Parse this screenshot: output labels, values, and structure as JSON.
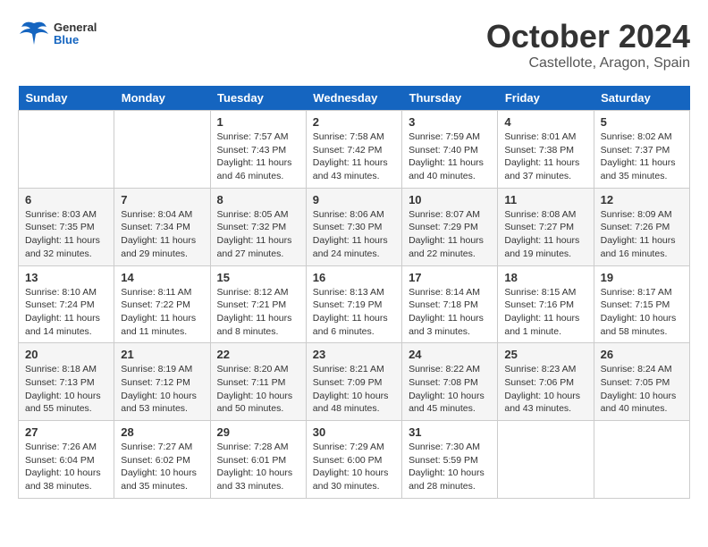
{
  "header": {
    "logo_general": "General",
    "logo_blue": "Blue",
    "month_title": "October 2024",
    "location": "Castellote, Aragon, Spain"
  },
  "days_of_week": [
    "Sunday",
    "Monday",
    "Tuesday",
    "Wednesday",
    "Thursday",
    "Friday",
    "Saturday"
  ],
  "weeks": [
    [
      {
        "day": "",
        "sunrise": "",
        "sunset": "",
        "daylight": ""
      },
      {
        "day": "",
        "sunrise": "",
        "sunset": "",
        "daylight": ""
      },
      {
        "day": "1",
        "sunrise": "Sunrise: 7:57 AM",
        "sunset": "Sunset: 7:43 PM",
        "daylight": "Daylight: 11 hours and 46 minutes."
      },
      {
        "day": "2",
        "sunrise": "Sunrise: 7:58 AM",
        "sunset": "Sunset: 7:42 PM",
        "daylight": "Daylight: 11 hours and 43 minutes."
      },
      {
        "day": "3",
        "sunrise": "Sunrise: 7:59 AM",
        "sunset": "Sunset: 7:40 PM",
        "daylight": "Daylight: 11 hours and 40 minutes."
      },
      {
        "day": "4",
        "sunrise": "Sunrise: 8:01 AM",
        "sunset": "Sunset: 7:38 PM",
        "daylight": "Daylight: 11 hours and 37 minutes."
      },
      {
        "day": "5",
        "sunrise": "Sunrise: 8:02 AM",
        "sunset": "Sunset: 7:37 PM",
        "daylight": "Daylight: 11 hours and 35 minutes."
      }
    ],
    [
      {
        "day": "6",
        "sunrise": "Sunrise: 8:03 AM",
        "sunset": "Sunset: 7:35 PM",
        "daylight": "Daylight: 11 hours and 32 minutes."
      },
      {
        "day": "7",
        "sunrise": "Sunrise: 8:04 AM",
        "sunset": "Sunset: 7:34 PM",
        "daylight": "Daylight: 11 hours and 29 minutes."
      },
      {
        "day": "8",
        "sunrise": "Sunrise: 8:05 AM",
        "sunset": "Sunset: 7:32 PM",
        "daylight": "Daylight: 11 hours and 27 minutes."
      },
      {
        "day": "9",
        "sunrise": "Sunrise: 8:06 AM",
        "sunset": "Sunset: 7:30 PM",
        "daylight": "Daylight: 11 hours and 24 minutes."
      },
      {
        "day": "10",
        "sunrise": "Sunrise: 8:07 AM",
        "sunset": "Sunset: 7:29 PM",
        "daylight": "Daylight: 11 hours and 22 minutes."
      },
      {
        "day": "11",
        "sunrise": "Sunrise: 8:08 AM",
        "sunset": "Sunset: 7:27 PM",
        "daylight": "Daylight: 11 hours and 19 minutes."
      },
      {
        "day": "12",
        "sunrise": "Sunrise: 8:09 AM",
        "sunset": "Sunset: 7:26 PM",
        "daylight": "Daylight: 11 hours and 16 minutes."
      }
    ],
    [
      {
        "day": "13",
        "sunrise": "Sunrise: 8:10 AM",
        "sunset": "Sunset: 7:24 PM",
        "daylight": "Daylight: 11 hours and 14 minutes."
      },
      {
        "day": "14",
        "sunrise": "Sunrise: 8:11 AM",
        "sunset": "Sunset: 7:22 PM",
        "daylight": "Daylight: 11 hours and 11 minutes."
      },
      {
        "day": "15",
        "sunrise": "Sunrise: 8:12 AM",
        "sunset": "Sunset: 7:21 PM",
        "daylight": "Daylight: 11 hours and 8 minutes."
      },
      {
        "day": "16",
        "sunrise": "Sunrise: 8:13 AM",
        "sunset": "Sunset: 7:19 PM",
        "daylight": "Daylight: 11 hours and 6 minutes."
      },
      {
        "day": "17",
        "sunrise": "Sunrise: 8:14 AM",
        "sunset": "Sunset: 7:18 PM",
        "daylight": "Daylight: 11 hours and 3 minutes."
      },
      {
        "day": "18",
        "sunrise": "Sunrise: 8:15 AM",
        "sunset": "Sunset: 7:16 PM",
        "daylight": "Daylight: 11 hours and 1 minute."
      },
      {
        "day": "19",
        "sunrise": "Sunrise: 8:17 AM",
        "sunset": "Sunset: 7:15 PM",
        "daylight": "Daylight: 10 hours and 58 minutes."
      }
    ],
    [
      {
        "day": "20",
        "sunrise": "Sunrise: 8:18 AM",
        "sunset": "Sunset: 7:13 PM",
        "daylight": "Daylight: 10 hours and 55 minutes."
      },
      {
        "day": "21",
        "sunrise": "Sunrise: 8:19 AM",
        "sunset": "Sunset: 7:12 PM",
        "daylight": "Daylight: 10 hours and 53 minutes."
      },
      {
        "day": "22",
        "sunrise": "Sunrise: 8:20 AM",
        "sunset": "Sunset: 7:11 PM",
        "daylight": "Daylight: 10 hours and 50 minutes."
      },
      {
        "day": "23",
        "sunrise": "Sunrise: 8:21 AM",
        "sunset": "Sunset: 7:09 PM",
        "daylight": "Daylight: 10 hours and 48 minutes."
      },
      {
        "day": "24",
        "sunrise": "Sunrise: 8:22 AM",
        "sunset": "Sunset: 7:08 PM",
        "daylight": "Daylight: 10 hours and 45 minutes."
      },
      {
        "day": "25",
        "sunrise": "Sunrise: 8:23 AM",
        "sunset": "Sunset: 7:06 PM",
        "daylight": "Daylight: 10 hours and 43 minutes."
      },
      {
        "day": "26",
        "sunrise": "Sunrise: 8:24 AM",
        "sunset": "Sunset: 7:05 PM",
        "daylight": "Daylight: 10 hours and 40 minutes."
      }
    ],
    [
      {
        "day": "27",
        "sunrise": "Sunrise: 7:26 AM",
        "sunset": "Sunset: 6:04 PM",
        "daylight": "Daylight: 10 hours and 38 minutes."
      },
      {
        "day": "28",
        "sunrise": "Sunrise: 7:27 AM",
        "sunset": "Sunset: 6:02 PM",
        "daylight": "Daylight: 10 hours and 35 minutes."
      },
      {
        "day": "29",
        "sunrise": "Sunrise: 7:28 AM",
        "sunset": "Sunset: 6:01 PM",
        "daylight": "Daylight: 10 hours and 33 minutes."
      },
      {
        "day": "30",
        "sunrise": "Sunrise: 7:29 AM",
        "sunset": "Sunset: 6:00 PM",
        "daylight": "Daylight: 10 hours and 30 minutes."
      },
      {
        "day": "31",
        "sunrise": "Sunrise: 7:30 AM",
        "sunset": "Sunset: 5:59 PM",
        "daylight": "Daylight: 10 hours and 28 minutes."
      },
      {
        "day": "",
        "sunrise": "",
        "sunset": "",
        "daylight": ""
      },
      {
        "day": "",
        "sunrise": "",
        "sunset": "",
        "daylight": ""
      }
    ]
  ]
}
